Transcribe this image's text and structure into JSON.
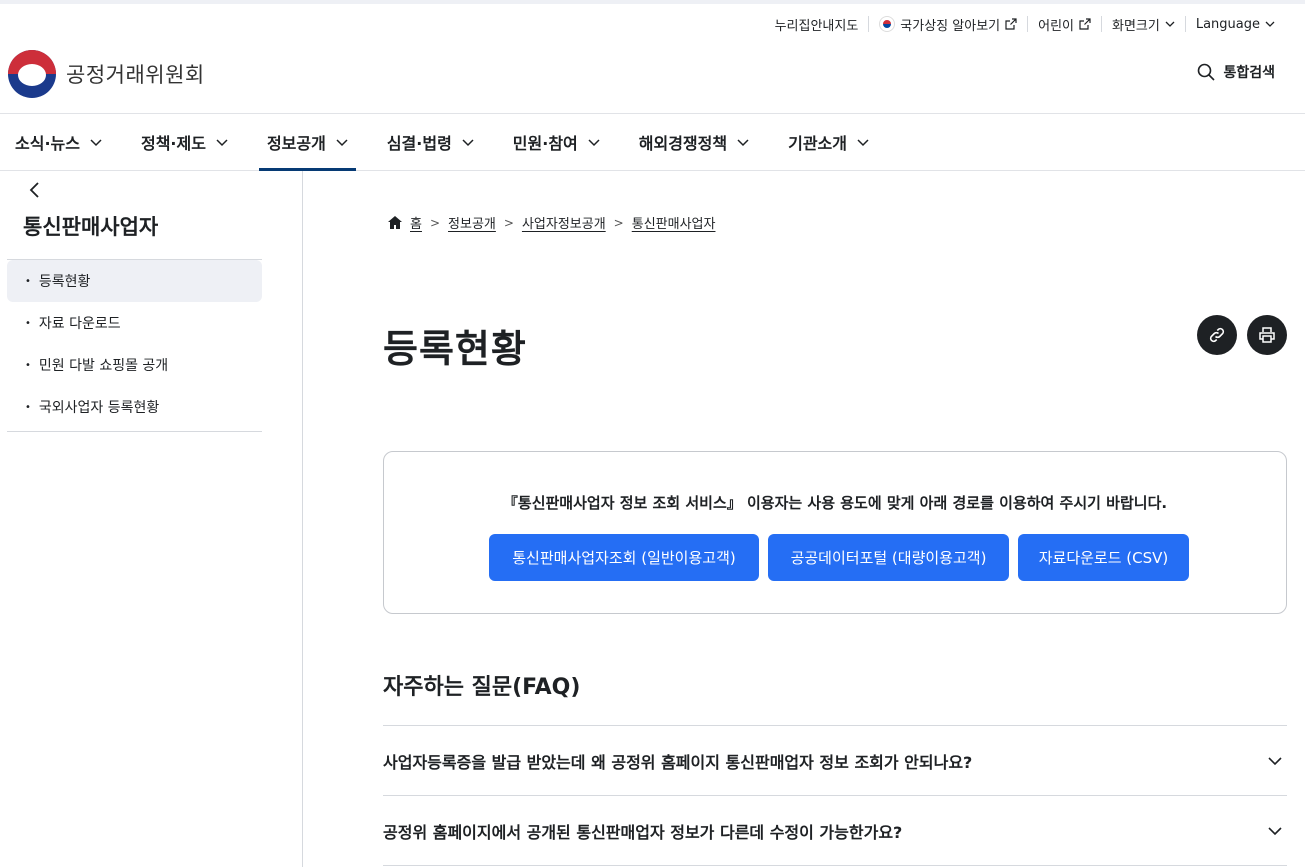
{
  "utility": {
    "sitemap": "누리집안내지도",
    "symbols": "국가상징 알아보기",
    "kids": "어린이",
    "zoom": "화면크기",
    "language": "Language"
  },
  "header": {
    "org_name": "공정거래위원회",
    "search_label": "통합검색"
  },
  "nav": {
    "items": [
      "소식·뉴스",
      "정책·제도",
      "정보공개",
      "심결·법령",
      "민원·참여",
      "해외경쟁정책",
      "기관소개"
    ],
    "active_index": 2
  },
  "sidebar": {
    "title": "통신판매사업자",
    "items": [
      "등록현황",
      "자료 다운로드",
      "민원 다발 쇼핑몰 공개",
      "국외사업자 등록현황"
    ],
    "active_index": 0
  },
  "breadcrumb": [
    "홈",
    "정보공개",
    "사업자정보공개",
    "통신판매사업자"
  ],
  "main": {
    "title": "등록현황",
    "notice_text": "『통신판매사업자 정보 조회 서비스』 이용자는 사용 용도에 맞게 아래 경로를 이용하여 주시기 바랍니다.",
    "buttons": [
      "통신판매사업자조회 (일반이용고객)",
      "공공데이터포털 (대량이용고객)",
      "자료다운로드 (CSV)"
    ]
  },
  "faq": {
    "title": "자주하는 질문(FAQ)",
    "items": [
      "사업자등록증을 발급 받았는데 왜 공정위 홈페이지 통신판매업자 정보 조회가 안되나요?",
      "공정위 홈페이지에서 공개된 통신판매업자 정보가 다른데 수정이 가능한가요?"
    ]
  },
  "colors": {
    "primary_button": "#256ef4",
    "nav_active": "#063a74"
  }
}
